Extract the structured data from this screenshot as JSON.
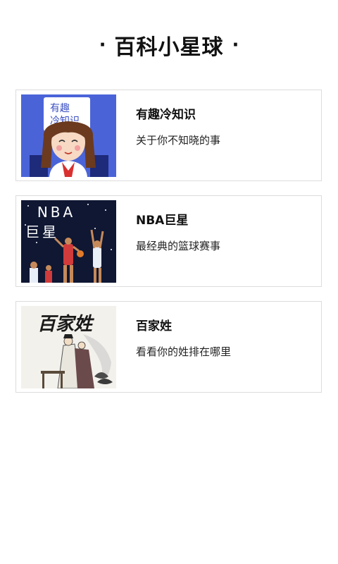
{
  "header": {
    "title": "百科小星球",
    "dot_left": "·",
    "dot_right": "·"
  },
  "cards": [
    {
      "title": "有趣冷知识",
      "subtitle": "关于你不知晓的事",
      "thumb_text_1": "有趣",
      "thumb_text_2": "冷知识",
      "thumb_bg": "#4a64d8"
    },
    {
      "title": "NBA巨星",
      "subtitle": "最经典的篮球赛事",
      "thumb_text_1": "NBA",
      "thumb_text_2": "巨星",
      "thumb_bg": "#0f1733"
    },
    {
      "title": "百家姓",
      "subtitle": "看看你的姓排在哪里",
      "thumb_text_1": "百家姓",
      "thumb_bg": "#f3f1ec"
    }
  ]
}
